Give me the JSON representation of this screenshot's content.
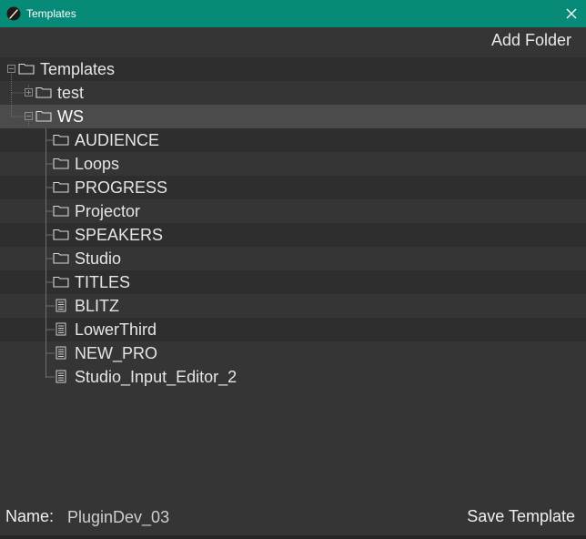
{
  "window": {
    "title": "Templates",
    "accent_color": "#078a77"
  },
  "toolbar": {
    "add_folder_label": "Add Folder"
  },
  "tree": {
    "root": {
      "label": "Templates",
      "type": "folder",
      "expanded": true
    },
    "items": [
      {
        "label": "test",
        "type": "folder",
        "expanded": false
      },
      {
        "label": "WS",
        "type": "folder",
        "expanded": true,
        "selected": true
      },
      {
        "label": "AUDIENCE",
        "type": "folder"
      },
      {
        "label": "Loops",
        "type": "folder"
      },
      {
        "label": "PROGRESS",
        "type": "folder"
      },
      {
        "label": "Projector",
        "type": "folder"
      },
      {
        "label": "SPEAKERS",
        "type": "folder"
      },
      {
        "label": "Studio",
        "type": "folder"
      },
      {
        "label": "TITLES",
        "type": "folder"
      },
      {
        "label": "BLITZ",
        "type": "file"
      },
      {
        "label": "LowerThird",
        "type": "file"
      },
      {
        "label": "NEW_PRO",
        "type": "file"
      },
      {
        "label": "Studio_Input_Editor_2",
        "type": "file"
      }
    ]
  },
  "footer": {
    "name_label": "Name:",
    "name_value": "PluginDev_03",
    "save_label": "Save Template"
  }
}
